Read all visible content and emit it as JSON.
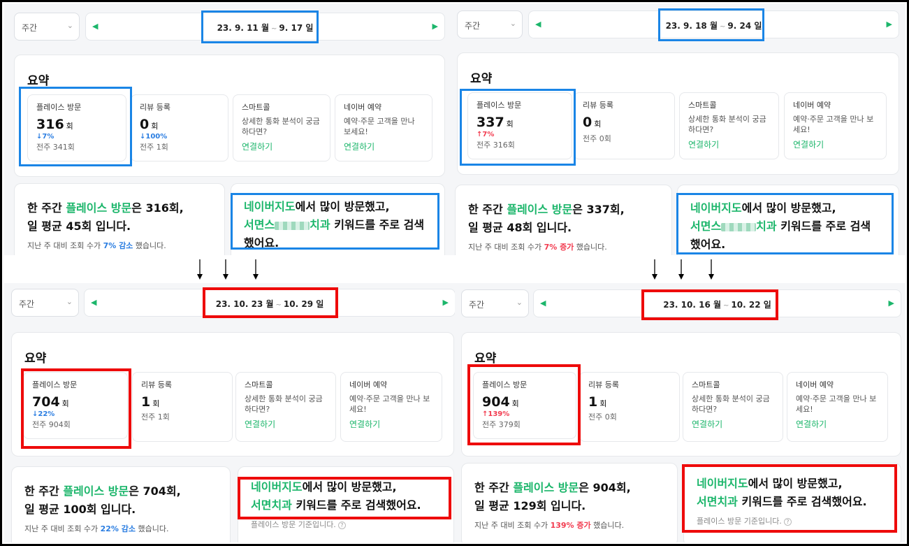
{
  "shared": {
    "period_option": "주간",
    "tilde": "~",
    "summary_title": "요약",
    "cards": {
      "visit_label": "플레이스 방문",
      "review_label": "리뷰 등록",
      "smartcall_label": "스마트콜",
      "smartcall_desc": "상세한 통화 분석이 궁금하다면?",
      "reserve_label": "네이버 예약",
      "reserve_desc": "예약·주문 고객을 만나 보세요!",
      "connect_link": "연결하기",
      "unit": "회"
    },
    "visit_text": {
      "prefix": "한 주간 ",
      "keyword": "플레이스 방문",
      "particle": "은 ",
      "daily_prefix": "일 평균 ",
      "daily_suffix": " 입니다.",
      "compare_prefix": "지난 주 대비 조회 수가 ",
      "compare_suffix": " 했습니다."
    },
    "kw_text": {
      "map": "네이버지도",
      "after_map": "에서 많이 방문했고,",
      "after_name": " 키워드를 주로 검색",
      "ended": "했어요.",
      "note": "플레이스 방문 기준입니다."
    }
  },
  "panels": [
    {
      "id": "p1",
      "range_start": "23. 9. 11 월",
      "range_end": "9. 17 일",
      "visits": "316",
      "visit_change": "↓7%",
      "visit_change_dir": "down",
      "visit_prev": "전주 341회",
      "reviews": "0",
      "review_change": "↓100%",
      "review_prev": "전주 1회",
      "weekly_count": "316회,",
      "daily_avg": "45회",
      "compare_value": "7% 감소",
      "kw_name_lead": "서면스",
      "kw_name_tail": "치과"
    },
    {
      "id": "p2",
      "range_start": "23. 9. 18 월",
      "range_end": "9. 24 일",
      "visits": "337",
      "visit_change": "↑7%",
      "visit_change_dir": "up",
      "visit_prev": "전주 316회",
      "reviews": "0",
      "review_change": "",
      "review_prev": "전주 0회",
      "weekly_count": "337회,",
      "daily_avg": "48회",
      "compare_value": "7% 증가",
      "kw_name_lead": "서면스",
      "kw_name_tail": "치과"
    },
    {
      "id": "p3",
      "range_start": "23. 10. 23 월",
      "range_end": "10. 29 일",
      "visits": "704",
      "visit_change": "↓22%",
      "visit_change_dir": "down",
      "visit_prev": "전주 904회",
      "reviews": "1",
      "review_change": "",
      "review_prev": "전주 1회",
      "weekly_count": "704회,",
      "daily_avg": "100회",
      "compare_value": "22% 감소",
      "kw_name": "서면치과"
    },
    {
      "id": "p4",
      "range_start": "23. 10. 16 월",
      "range_end": "10. 22 일",
      "visits": "904",
      "visit_change": "↑139%",
      "visit_change_dir": "up",
      "visit_prev": "전주 379회",
      "reviews": "1",
      "review_change": "",
      "review_prev": "전주 0회",
      "weekly_count": "904회,",
      "daily_avg": "129회",
      "compare_value": "139% 증가",
      "kw_name": "서면치과"
    }
  ],
  "colors": {
    "green": "#1cb66b",
    "blue_highlight": "#1a85e6",
    "red_highlight": "#ee0b0b",
    "down": "#2a7de1",
    "up": "#f23b4f"
  },
  "icons": {
    "prev": "caret-left-icon",
    "next": "caret-right-icon",
    "dropdown": "chevron-down-icon",
    "help": "question-circle-icon",
    "arrow": "arrow-down-icon"
  }
}
